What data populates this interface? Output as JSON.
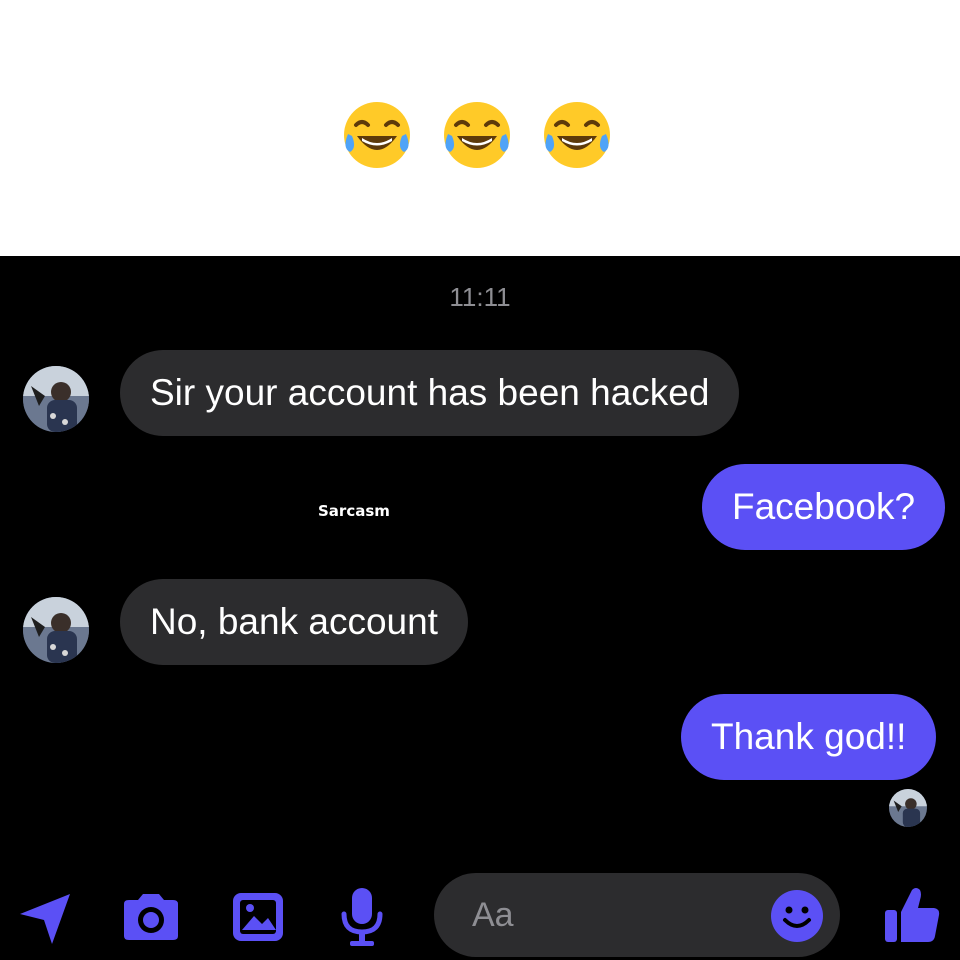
{
  "caption": {
    "emojis": [
      "face-with-tears-of-joy",
      "face-with-tears-of-joy",
      "face-with-tears-of-joy"
    ]
  },
  "chat": {
    "timestamp": "11:11",
    "messages": [
      {
        "direction": "incoming",
        "text": "Sir your account has been hacked"
      },
      {
        "direction": "outgoing",
        "text": "Facebook?"
      },
      {
        "direction": "incoming",
        "text": "No, bank account"
      },
      {
        "direction": "outgoing",
        "text": "Thank god!!"
      }
    ],
    "watermark": "Sarcasm"
  },
  "composer": {
    "placeholder": "Aa",
    "icons": [
      "location-arrow-icon",
      "camera-icon",
      "image-icon",
      "microphone-icon",
      "emoji-icon",
      "thumbs-up-icon"
    ]
  },
  "colors": {
    "accent": "#5b50f5",
    "incoming_bubble": "#2c2c2e",
    "background": "#000000",
    "timestamp": "#8e8e93"
  }
}
